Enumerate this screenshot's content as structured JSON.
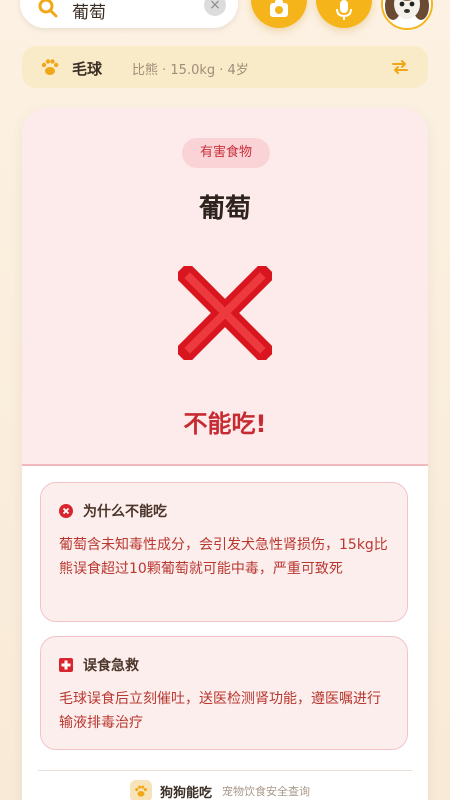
{
  "search": {
    "value": "葡萄",
    "clear_label": "×"
  },
  "pet": {
    "name": "毛球",
    "details": "比熊 · 15.0kg · 4岁"
  },
  "result": {
    "tag": "有害食物",
    "food_name": "葡萄",
    "verdict": "不能吃!"
  },
  "reason": {
    "title": "为什么不能吃",
    "text": "葡萄含未知毒性成分，会引发犬急性肾损伤，15kg比熊误食超过10颗葡萄就可能中毒，严重可致死"
  },
  "first_aid": {
    "title": "误食急救",
    "text": "毛球误食后立刻催吐，送医检测肾功能，遵医嘱进行输液排毒治疗"
  },
  "footer": {
    "brand": "狗狗能吃",
    "slogan": "宠物饮食安全查询"
  },
  "colors": {
    "accent": "#f6b41b",
    "danger": "#c72b32",
    "danger_bg": "#fdebec"
  }
}
